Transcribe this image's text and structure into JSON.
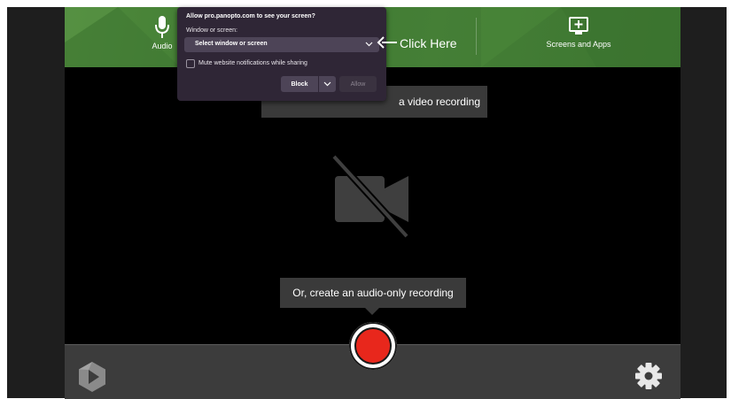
{
  "toolbar": {
    "audio_label": "Audio",
    "screens_label": "Screens and Apps"
  },
  "stage": {
    "hint_text": "a video recording",
    "audio_only_tip": "Or, create an audio-only recording"
  },
  "permission_dialog": {
    "title": "Allow pro.panopto.com to see your screen?",
    "subtitle": "Window or screen:",
    "select_value": "Select window or screen",
    "mute_label": "Mute website notifications while sharing",
    "block_label": "Block",
    "allow_label": "Allow"
  },
  "annotation": {
    "text": "Click Here"
  },
  "colors": {
    "toolbar_green": "#447f35",
    "record_red": "#e8271c",
    "dialog_bg": "#2f2636"
  },
  "icons": {
    "audio": "microphone-icon",
    "screens": "monitor-plus-icon",
    "camera": "camera-off-icon",
    "logo": "panopto-logo-icon",
    "settings": "gear-icon"
  }
}
